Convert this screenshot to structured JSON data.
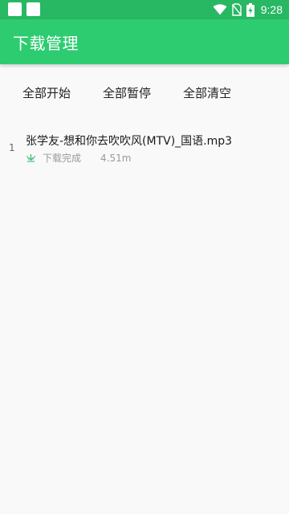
{
  "status_bar": {
    "time": "9:28",
    "icons": [
      "notification-square-icon",
      "notification-square-icon",
      "wifi-icon",
      "no-sim-icon",
      "battery-charging-icon"
    ]
  },
  "app_bar": {
    "title": "下载管理",
    "color": "#2ecc71",
    "status_color": "#28b864"
  },
  "actions": {
    "start_all": "全部开始",
    "pause_all": "全部暂停",
    "clear_all": "全部清空"
  },
  "downloads": [
    {
      "index": "1",
      "title": "张学友-想和你去吹吹风(MTV)_国语.mp3",
      "status_icon": "download-complete-icon",
      "status": "下载完成",
      "size": "4.51m"
    }
  ]
}
